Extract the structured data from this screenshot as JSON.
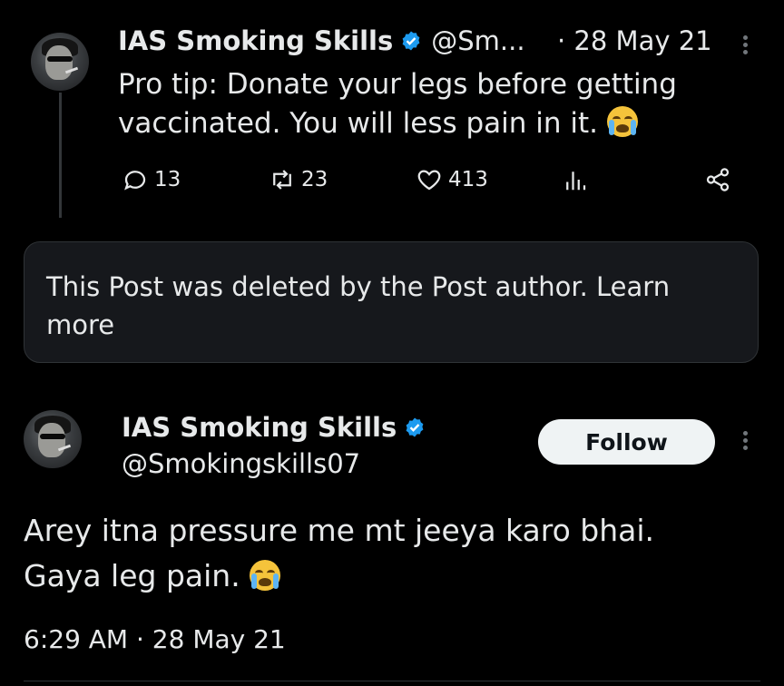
{
  "reply_tweet": {
    "author_name": "IAS Smoking Skills",
    "handle_truncated": "@Sm...",
    "date": "· 28 May 21",
    "text": "Pro tip: Donate your legs before getting vaccinated. You will less pain in it.",
    "emoji": "loudly-crying-face",
    "actions": {
      "replies": "13",
      "reposts": "23",
      "likes": "413"
    }
  },
  "deleted_notice": {
    "text": "This Post was deleted by the Post author.",
    "link": "Learn more"
  },
  "main_tweet": {
    "author_name": "IAS Smoking Skills",
    "handle": "@Smokingskills07",
    "follow_label": "Follow",
    "text_line1": "Arey itna pressure me mt jeeya karo bhai.",
    "text_line2": "Gaya leg pain.",
    "emoji": "loudly-crying-face",
    "timestamp": "6:29 AM · 28 May 21"
  },
  "colors": {
    "background": "#000000",
    "text": "#e7e9ea",
    "muted": "#71767b",
    "verified": "#1d9bf0",
    "card": "#16181c"
  }
}
